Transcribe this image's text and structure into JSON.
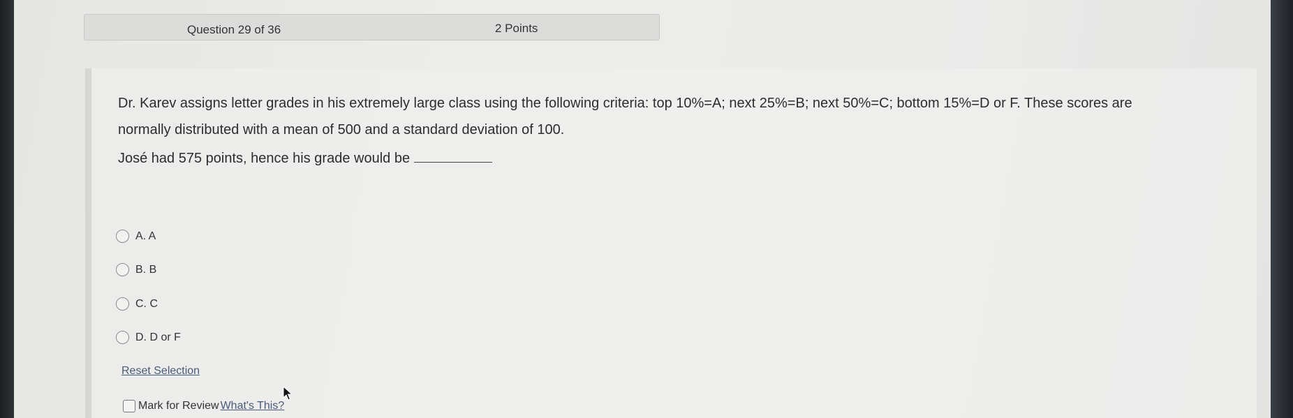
{
  "header": {
    "question_counter": "Question 29 of 36",
    "points": "2 Points"
  },
  "question": {
    "text": "Dr. Karev assigns letter grades in his extremely large class using the following criteria: top 10%=A; next 25%=B; next 50%=C; bottom 15%=D or F. These scores are normally distributed with a mean of 500 and a standard deviation of 100.",
    "prompt": "José had 575 points, hence his grade would be"
  },
  "options": [
    {
      "label": "A. A",
      "selected": false
    },
    {
      "label": "B. B",
      "selected": false
    },
    {
      "label": "C. C",
      "selected": false
    },
    {
      "label": "D. D or F",
      "selected": false
    }
  ],
  "reset_selection_label": "Reset Selection",
  "review": {
    "label": "Mark for Review",
    "whats_this": "What's This?",
    "checked": false
  },
  "icons": {
    "radio": "radio-button-icon",
    "checkbox": "checkbox-icon",
    "cursor": "mouse-pointer-icon"
  }
}
